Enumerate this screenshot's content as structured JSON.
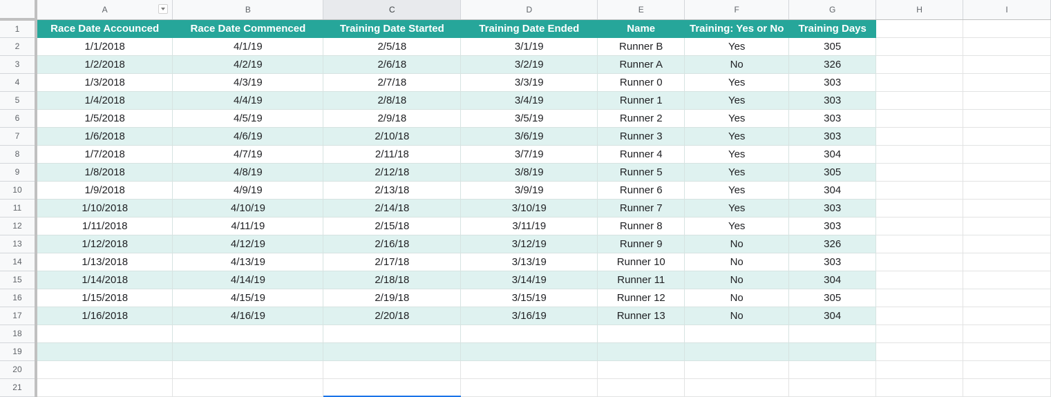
{
  "column_letters": [
    "A",
    "B",
    "C",
    "D",
    "E",
    "F",
    "G",
    "H",
    "I"
  ],
  "selected_column": "C",
  "row_numbers": [
    "1",
    "2",
    "3",
    "4",
    "5",
    "6",
    "7",
    "8",
    "9",
    "10",
    "11",
    "12",
    "13",
    "14",
    "15",
    "16",
    "17",
    "18",
    "19",
    "20",
    "21"
  ],
  "header": [
    "Race Date Accounced",
    "Race Date Commenced",
    "Training Date Started",
    "Training Date Ended",
    "Name",
    "Training: Yes or No",
    "Training Days"
  ],
  "rows": [
    [
      "1/1/2018",
      "4/1/19",
      "2/5/18",
      "3/1/19",
      "Runner B",
      "Yes",
      "305"
    ],
    [
      "1/2/2018",
      "4/2/19",
      "2/6/18",
      "3/2/19",
      "Runner A",
      "No",
      "326"
    ],
    [
      "1/3/2018",
      "4/3/19",
      "2/7/18",
      "3/3/19",
      "Runner 0",
      "Yes",
      "303"
    ],
    [
      "1/4/2018",
      "4/4/19",
      "2/8/18",
      "3/4/19",
      "Runner 1",
      "Yes",
      "303"
    ],
    [
      "1/5/2018",
      "4/5/19",
      "2/9/18",
      "3/5/19",
      "Runner 2",
      "Yes",
      "303"
    ],
    [
      "1/6/2018",
      "4/6/19",
      "2/10/18",
      "3/6/19",
      "Runner 3",
      "Yes",
      "303"
    ],
    [
      "1/7/2018",
      "4/7/19",
      "2/11/18",
      "3/7/19",
      "Runner 4",
      "Yes",
      "304"
    ],
    [
      "1/8/2018",
      "4/8/19",
      "2/12/18",
      "3/8/19",
      "Runner 5",
      "Yes",
      "305"
    ],
    [
      "1/9/2018",
      "4/9/19",
      "2/13/18",
      "3/9/19",
      "Runner 6",
      "Yes",
      "304"
    ],
    [
      "1/10/2018",
      "4/10/19",
      "2/14/18",
      "3/10/19",
      "Runner 7",
      "Yes",
      "303"
    ],
    [
      "1/11/2018",
      "4/11/19",
      "2/15/18",
      "3/11/19",
      "Runner 8",
      "Yes",
      "303"
    ],
    [
      "1/12/2018",
      "4/12/19",
      "2/16/18",
      "3/12/19",
      "Runner 9",
      "No",
      "326"
    ],
    [
      "1/13/2018",
      "4/13/19",
      "2/17/18",
      "3/13/19",
      "Runner 10",
      "No",
      "303"
    ],
    [
      "1/14/2018",
      "4/14/19",
      "2/18/18",
      "3/14/19",
      "Runner 11",
      "No",
      "304"
    ],
    [
      "1/15/2018",
      "4/15/19",
      "2/19/18",
      "3/15/19",
      "Runner 12",
      "No",
      "305"
    ],
    [
      "1/16/2018",
      "4/16/19",
      "2/20/18",
      "3/16/19",
      "Runner 13",
      "No",
      "304"
    ],
    [
      "",
      "",
      "",
      "",
      "",
      "",
      ""
    ],
    [
      "",
      "",
      "",
      "",
      "",
      "",
      ""
    ],
    [
      "",
      "",
      "",
      "",
      "",
      "",
      ""
    ],
    [
      "",
      "",
      "",
      "",
      "",
      "",
      ""
    ]
  ],
  "colors": {
    "table_header": "#26a69a",
    "band_fill": "#dff2f0",
    "selection": "#1a73e8"
  }
}
